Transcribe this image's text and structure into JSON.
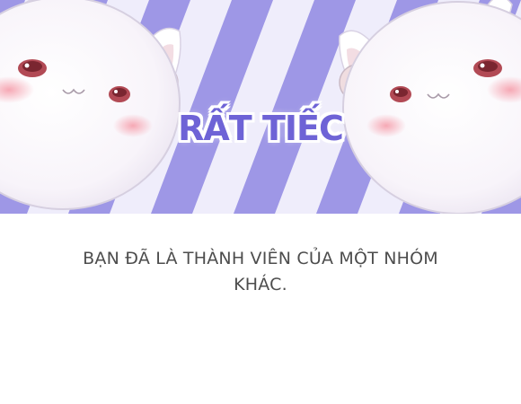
{
  "dialog": {
    "title": "RẤT TIẾC",
    "message": "BẠN ĐÃ LÀ THÀNH VIÊN CỦA MỘT NHÓM KHÁC."
  },
  "banner": {
    "stripe_color": "#9e97e6",
    "stripe_light_color": "#efedfb",
    "mascot_left": "bunny-mascot-icon",
    "mascot_right": "bunny-mascot-icon"
  },
  "colors": {
    "title": "#6e63d6",
    "message": "#4d4d4d",
    "background": "#ffffff"
  }
}
